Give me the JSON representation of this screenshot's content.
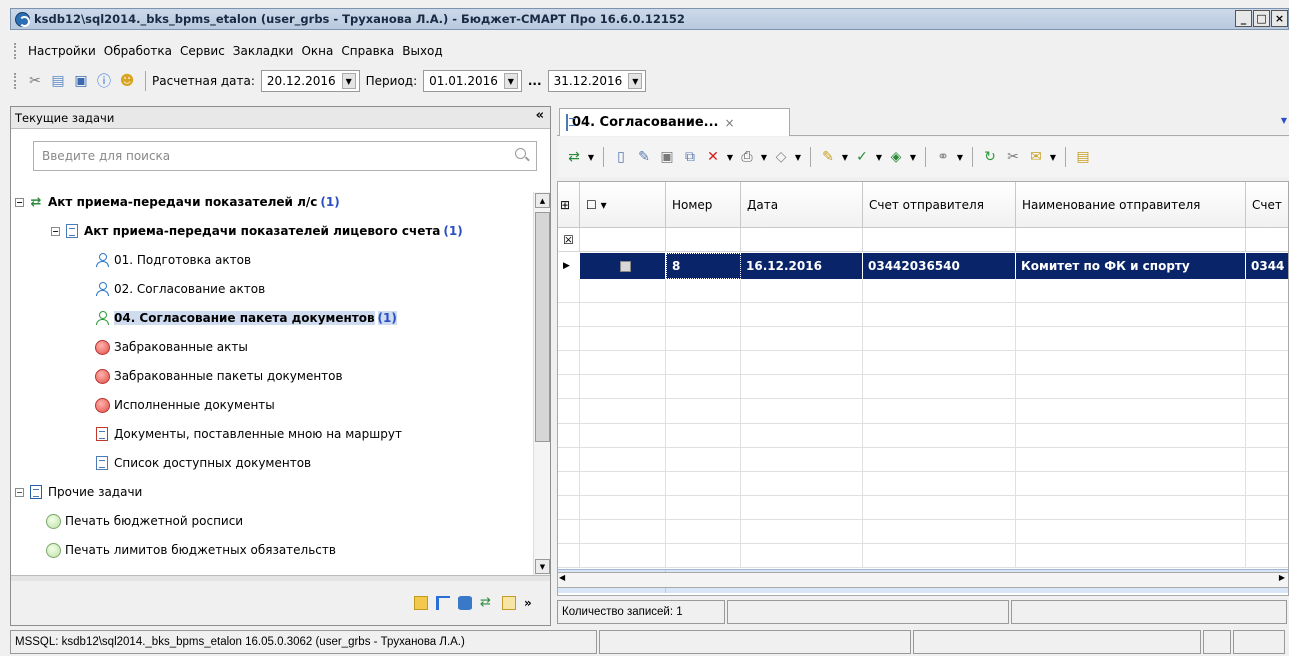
{
  "window": {
    "title": "ksdb12\\sql2014._bks_bpms_etalon (user_grbs - Труханова Л.А.) - Бюджет-СМАРТ Про 16.6.0.12152"
  },
  "menu": {
    "items": [
      "Настройки",
      "Обработка",
      "Сервис",
      "Закладки",
      "Окна",
      "Справка",
      "Выход"
    ]
  },
  "toolbar": {
    "calc_date_label": "Расчетная дата:",
    "calc_date_value": "20.12.2016",
    "period_label": "Период:",
    "period_from": "01.01.2016",
    "period_sep": "...",
    "period_to": "31.12.2016"
  },
  "left_panel": {
    "header": "Текущие задачи",
    "collapse_glyph": "«",
    "search_placeholder": "Введите для поиска",
    "tree": [
      {
        "label": "Акт приема-передачи показателей л/с",
        "count": "(1)"
      },
      {
        "label": "Акт приема-передачи показателей лицевого счета",
        "count": "(1)"
      },
      {
        "label": "01. Подготовка актов",
        "count": ""
      },
      {
        "label": "02. Согласование актов",
        "count": ""
      },
      {
        "label": "04. Согласование пакета документов",
        "count": "(1)"
      },
      {
        "label": "Забракованные акты",
        "count": ""
      },
      {
        "label": "Забракованные пакеты документов",
        "count": ""
      },
      {
        "label": "Исполненные документы",
        "count": ""
      },
      {
        "label": "Документы, поставленные мною на маршрут",
        "count": ""
      },
      {
        "label": "Список доступных документов",
        "count": ""
      },
      {
        "label": "Прочие задачи",
        "count": ""
      },
      {
        "label": "Печать бюджетной росписи",
        "count": ""
      },
      {
        "label": "Печать лимитов бюджетных обязательств",
        "count": ""
      }
    ]
  },
  "tab": {
    "label": "04. Согласование...",
    "close": "×"
  },
  "grid": {
    "columns": [
      "Номер",
      "Дата",
      "Счет отправителя",
      "Наименование отправителя",
      "Счет"
    ],
    "rows": [
      {
        "number": "8",
        "date": "16.12.2016",
        "account": "03442036540",
        "sender": "Комитет по ФК и спорту",
        "acc2": "0344"
      }
    ],
    "total_count": "1"
  },
  "status": {
    "records": "Количество записей: 1",
    "db": "MSSQL: ksdb12\\sql2014._bks_bpms_etalon 16.05.0.3062 (user_grbs - Труханова Л.А.)"
  },
  "colors": {
    "selection": "#0a246a",
    "title_bg": "#c4d2e6",
    "link_count": "#2a4fc5"
  }
}
